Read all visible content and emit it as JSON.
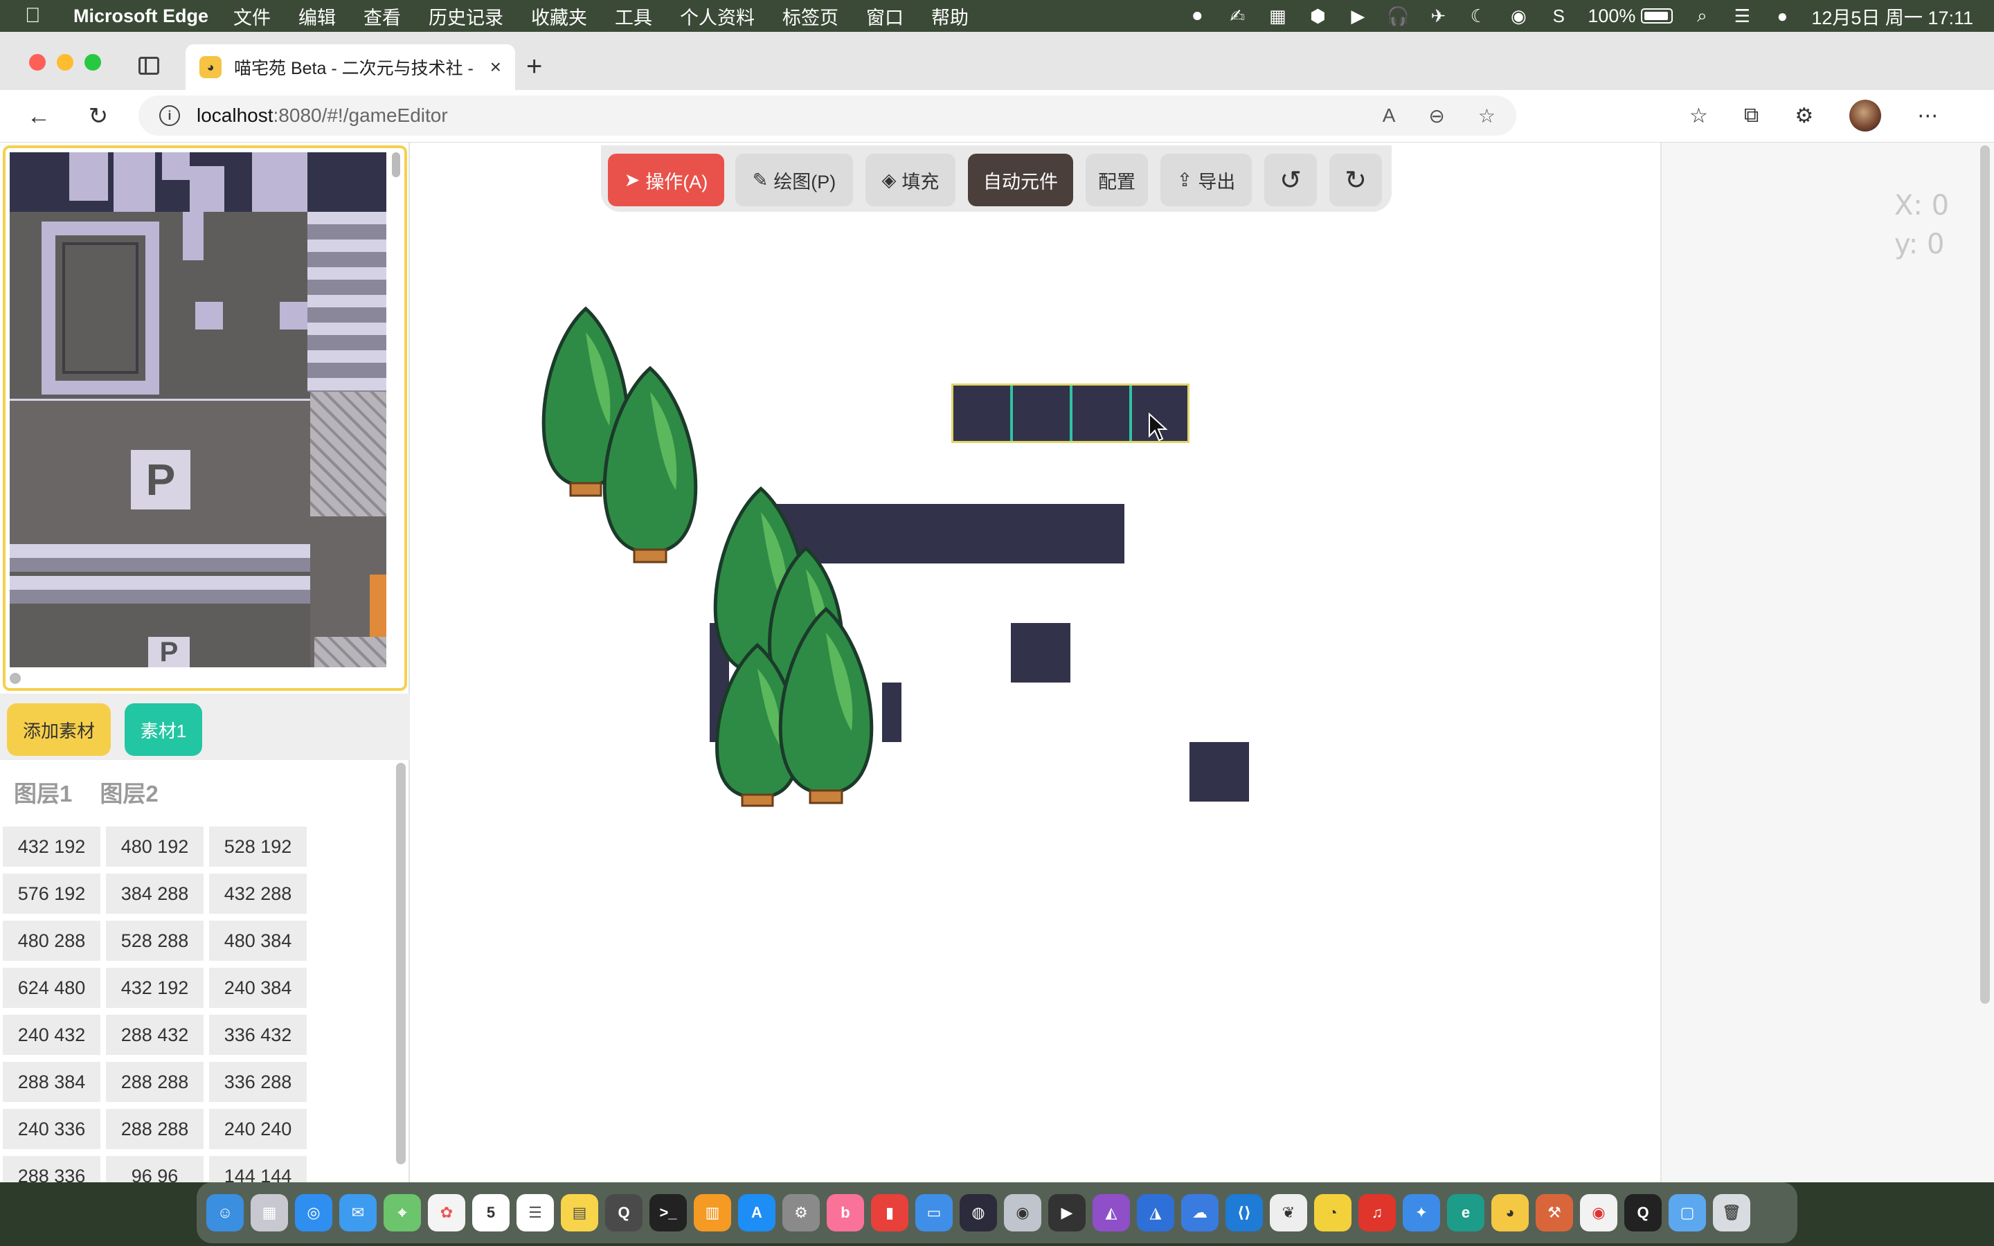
{
  "menubar": {
    "app_name": "Microsoft Edge",
    "items": [
      "文件",
      "编辑",
      "查看",
      "历史记录",
      "收藏夹",
      "工具",
      "个人资料",
      "标签页",
      "窗口",
      "帮助"
    ],
    "battery": "100%",
    "datetime": "12月5日 周一  17:11"
  },
  "browser": {
    "tab_title": "喵宅苑 Beta - 二次元与技术社 -",
    "url_host": "localhost",
    "url_path": ":8080/#!/gameEditor"
  },
  "left_panel": {
    "add_asset_label": "添加素材",
    "asset1_label": "素材1",
    "layers": [
      "图层1",
      "图层2"
    ],
    "tile_coords": [
      "432 192",
      "480 192",
      "528 192",
      "576 192",
      "384 288",
      "432 288",
      "480 288",
      "528 288",
      "480 384",
      "624 480",
      "432 192",
      "240 384",
      "240 432",
      "288 432",
      "336 432",
      "288 384",
      "288 288",
      "336 288",
      "240 336",
      "288 288",
      "240 240",
      "288 336",
      "96 96",
      "144 144"
    ]
  },
  "toolbar": {
    "operate": "操作(A)",
    "draw": "绘图(P)",
    "fill": "填充",
    "auto_component": "自动元件",
    "config": "配置",
    "export": "导出"
  },
  "coords": {
    "x_label": "X:  0",
    "y_label": "y:  0"
  },
  "colors": {
    "accent_red": "#e9524a",
    "accent_teal": "#23c6a3",
    "accent_yellow": "#f6cf4a",
    "tile_dark": "#32334a"
  }
}
